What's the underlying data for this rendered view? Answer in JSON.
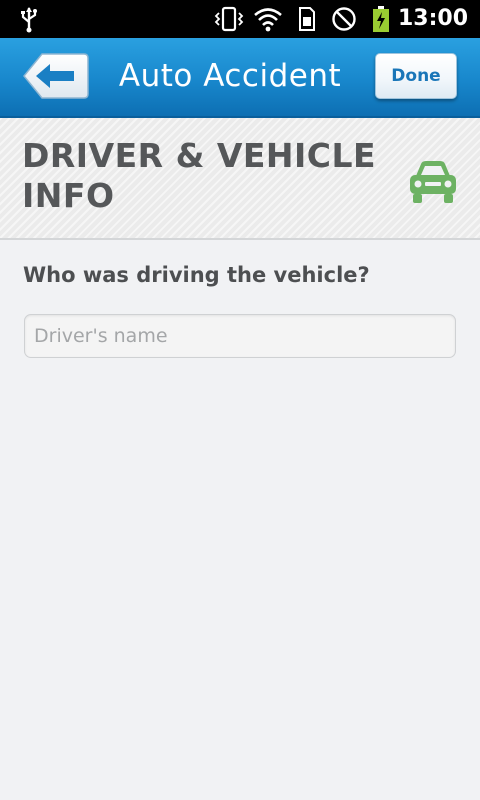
{
  "status_bar": {
    "time": "13:00",
    "icons": [
      "usb-icon",
      "vibrate-icon",
      "wifi-icon",
      "sim-icon",
      "no-sync-icon",
      "battery-charging-icon"
    ]
  },
  "action_bar": {
    "title": "Auto Accident",
    "back_icon": "back-arrow-icon",
    "done_label": "Done",
    "accent_color": "#1887cc"
  },
  "section": {
    "title": "DRIVER & VEHICLE INFO",
    "icon": "car-icon",
    "icon_color": "#6db263"
  },
  "form": {
    "question": "Who was driving the vehicle?",
    "driver_name": {
      "value": "",
      "placeholder": "Driver's name"
    }
  }
}
